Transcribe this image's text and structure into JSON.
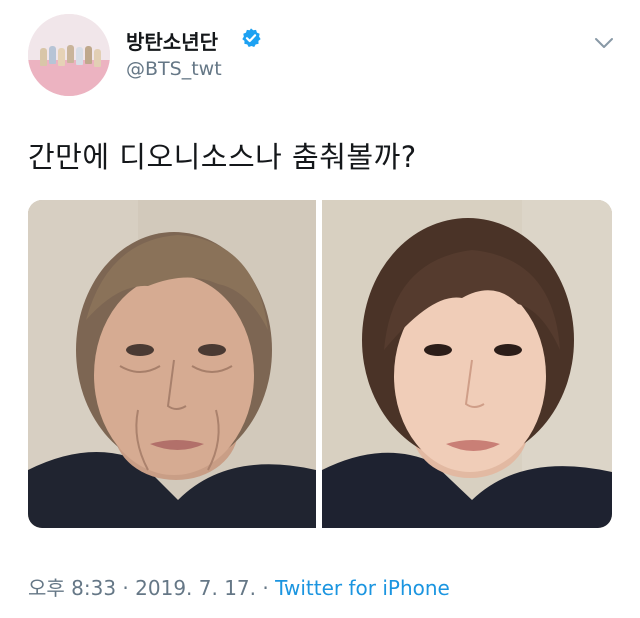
{
  "tweet": {
    "display_name": "방탄소년단",
    "handle": "@BTS_twt",
    "text": "간만에 디오니소스나 춤춰볼까?",
    "time": "오후 8:33",
    "separator": " · ",
    "date": "2019. 7. 17.",
    "source": "Twitter for iPhone"
  },
  "icons": {
    "verified": "verified-badge-icon",
    "menu": "chevron-down-icon"
  },
  "colors": {
    "verified_blue": "#1da1f2",
    "link_blue": "#1b95e0",
    "muted_gray": "#657786",
    "avatar_pink": "#ecb3c1"
  }
}
